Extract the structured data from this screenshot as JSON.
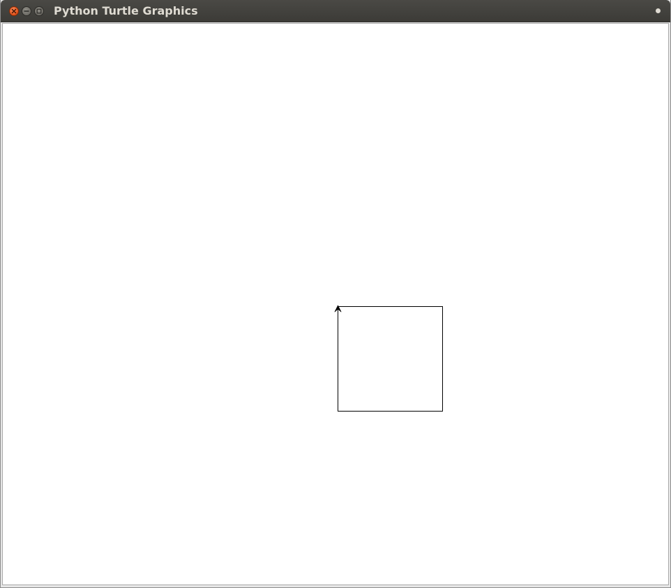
{
  "window": {
    "title": "Python Turtle Graphics"
  },
  "colors": {
    "titlebar": "#3c3b37",
    "title_text": "#dfdbd2",
    "close_button": "#e3531c",
    "canvas_background": "#ffffff",
    "pen": "#000000"
  },
  "icons": {
    "close": "close-icon",
    "minimize": "minimize-icon",
    "maximize": "maximize-icon",
    "menu": "window-menu-icon",
    "turtle": "arrow-turtle-icon"
  },
  "drawing": {
    "shape": "square",
    "turtle_heading": "up"
  }
}
